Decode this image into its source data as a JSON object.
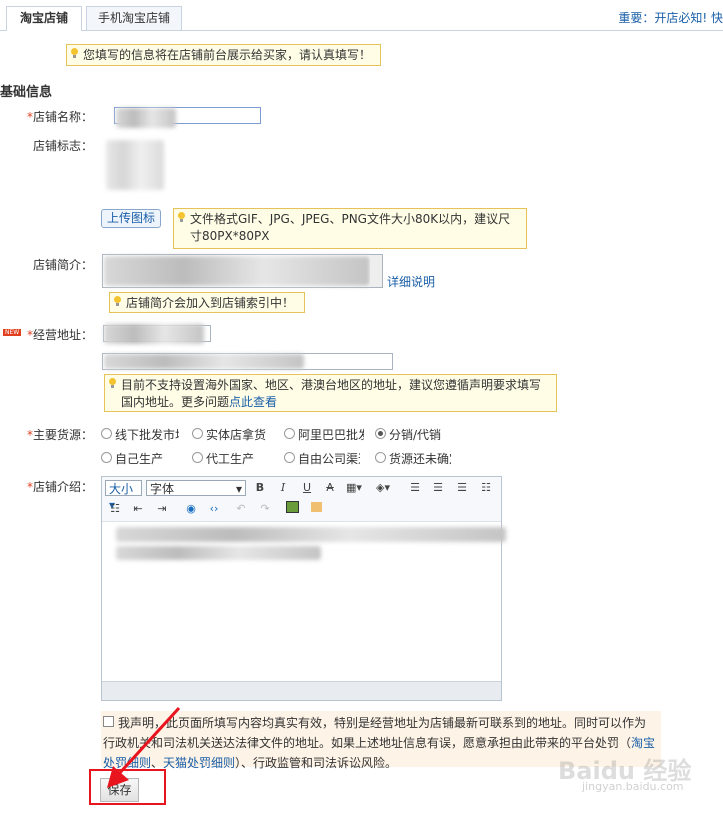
{
  "tabs": [
    {
      "label": "淘宝店铺"
    },
    {
      "label": "手机淘宝店铺"
    }
  ],
  "top_right": {
    "prefix": "重要：",
    "link": "开店必知",
    "suffix": "! 快"
  },
  "notice": "您填写的信息将在店铺前台展示给买家，请认真填写！",
  "section_title": "基础信息",
  "shop_name": {
    "required_mark": "*",
    "label": "店铺名称："
  },
  "shop_logo": {
    "label": "店铺标志：",
    "upload_button": "上传图标",
    "tip": "文件格式GIF、JPG、JPEG、PNG文件大小80K以内，建议尺寸80PX*80PX"
  },
  "shop_intro": {
    "label": "店铺简介：",
    "detail_link": "详细说明",
    "tip": "店铺简介会加入到店铺索引中！"
  },
  "address": {
    "new_badge": "NEW",
    "required_mark": "*",
    "label": "经营地址：",
    "tip_text": "目前不支持设置海外国家、地区、港澳台地区的地址，建议您遵循声明要求填写国内地址。更多问题",
    "tip_link": "点此查看"
  },
  "source": {
    "required_mark": "*",
    "label": "主要货源：",
    "options": [
      "线下批发市场",
      "实体店拿货",
      "阿里巴巴批发",
      "分销/代销",
      "自己生产",
      "代工生产",
      "自由公司渠道",
      "货源还未确定"
    ],
    "selected": "分销/代销"
  },
  "description": {
    "required_mark": "*",
    "label": "店铺介绍："
  },
  "editor": {
    "fontsize": "大小",
    "fontfamily": "字体",
    "bold": "B",
    "italic": "I",
    "underline": "U",
    "strike": "A"
  },
  "declaration": {
    "text1": "我声明，此页面所填写内容均真实有效，特别是经营地址为店铺最新可联系到的地址。同时可以作为行政机关和司法机关送达法律文件的地址。如果上述地址信息有误，愿意承担由此带来的平台处罚（",
    "link1": "淘宝处罚细则",
    "sep": "、",
    "link2": "天猫处罚细则",
    "text2": "）、行政监管和司法诉讼风险。"
  },
  "save_button": "保存",
  "watermark": {
    "brand": "Baidu 经验",
    "url": "jingyan.baidu.com"
  },
  "colors": {
    "link": "#1a5fa8",
    "required": "#dd4422",
    "tip_bg": "#fffde6",
    "tip_border": "#e6c35a",
    "highlight": "#e8141e"
  }
}
